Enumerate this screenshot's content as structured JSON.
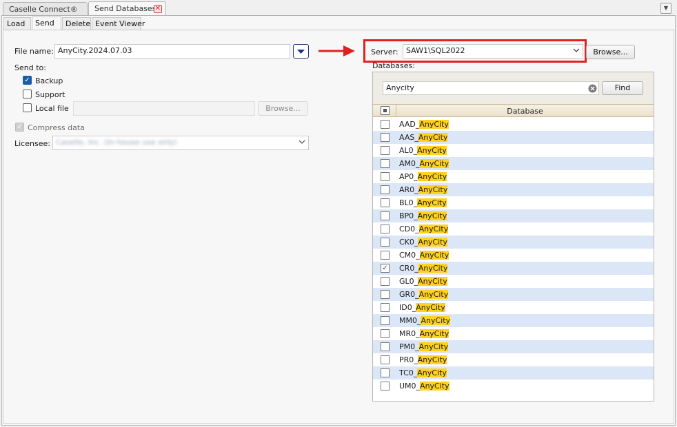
{
  "doc_tabs": [
    "Caselle Connect®",
    "Send Databases"
  ],
  "sub_tabs": [
    "Load",
    "Send",
    "Delete",
    "Event Viewer"
  ],
  "left": {
    "file_name_label": "File name:",
    "file_name_value": "AnyCity.2024.07.03",
    "send_to_label": "Send to:",
    "backup_label": "Backup",
    "support_label": "Support",
    "local_file_label": "Local file",
    "browse_label": "Browse...",
    "compress_label": "Compress data",
    "licensee_label": "Licensee:",
    "licensee_value": "Caselle, Inc. (In-house use only)"
  },
  "right": {
    "server_label": "Server:",
    "server_value": "SAW1\\SQL2022",
    "browse_label": "Browse...",
    "databases_label": "Databases:",
    "search_value": "Anycity",
    "find_label": "Find",
    "column_header": "Database"
  },
  "databases": [
    {
      "prefix": "AAD_",
      "match": "AnyCity",
      "checked": false
    },
    {
      "prefix": "AAS_",
      "match": "AnyCity",
      "checked": false
    },
    {
      "prefix": "AL0_",
      "match": "AnyCity",
      "checked": false
    },
    {
      "prefix": "AM0_",
      "match": "AnyCity",
      "checked": false
    },
    {
      "prefix": "AP0_",
      "match": "AnyCity",
      "checked": false
    },
    {
      "prefix": "AR0_",
      "match": "AnyCity",
      "checked": false
    },
    {
      "prefix": "BL0_",
      "match": "AnyCity",
      "checked": false
    },
    {
      "prefix": "BP0_",
      "match": "AnyCity",
      "checked": false
    },
    {
      "prefix": "CD0_",
      "match": "AnyCity",
      "checked": false
    },
    {
      "prefix": "CK0_",
      "match": "AnyCity",
      "checked": false
    },
    {
      "prefix": "CM0_",
      "match": "AnyCity",
      "checked": false
    },
    {
      "prefix": "CR0_",
      "match": "AnyCity",
      "checked": true
    },
    {
      "prefix": "GL0_",
      "match": "AnyCity",
      "checked": false
    },
    {
      "prefix": "GR0_",
      "match": "AnyCity",
      "checked": false
    },
    {
      "prefix": "ID0_",
      "match": "AnyCity",
      "checked": false
    },
    {
      "prefix": "MM0_",
      "match": "AnyCity",
      "checked": false
    },
    {
      "prefix": "MR0_",
      "match": "AnyCity",
      "checked": false
    },
    {
      "prefix": "PM0_",
      "match": "AnyCity",
      "checked": false
    },
    {
      "prefix": "PR0_",
      "match": "AnyCity",
      "checked": false
    },
    {
      "prefix": "TC0_",
      "match": "AnyCity",
      "checked": false
    },
    {
      "prefix": "UM0_",
      "match": "AnyCity",
      "checked": false
    }
  ],
  "icons": {
    "tab_close": "close-icon",
    "menu": "chevron-down-icon",
    "clear_search": "clear-icon",
    "annotation": "arrow-right-icon"
  },
  "colors": {
    "highlight": "#ffd21f",
    "annotation": "#e02020",
    "alt_row": "#dbe6f6",
    "checkbox_accent": "#1a5ea8"
  }
}
